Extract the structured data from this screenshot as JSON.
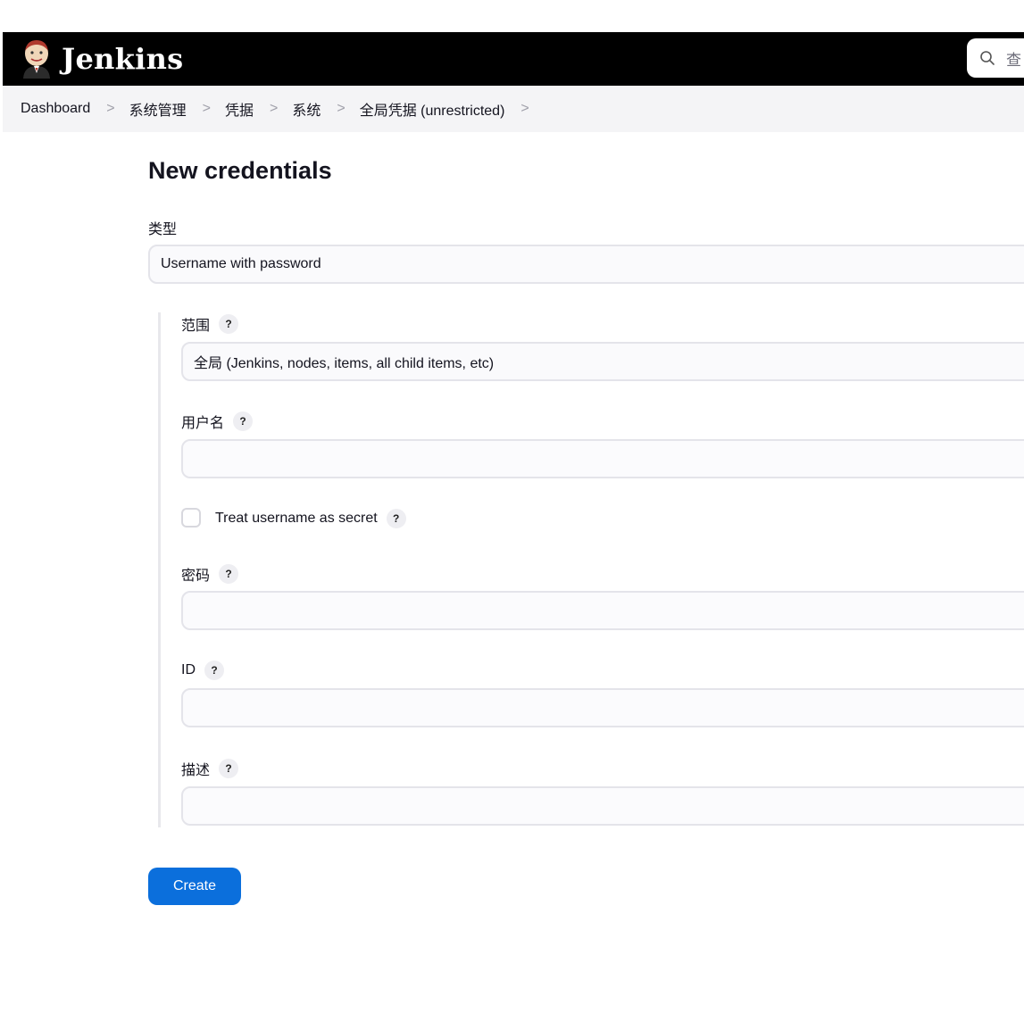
{
  "header": {
    "app_name": "Jenkins",
    "logo_icon": "jenkins-butler-icon",
    "search_icon": "search-icon",
    "search_placeholder": "查"
  },
  "breadcrumbs": [
    "Dashboard",
    "系统管理",
    "凭据",
    "系统",
    "全局凭据 (unrestricted)"
  ],
  "breadcrumb_separator": ">",
  "page": {
    "title": "New credentials"
  },
  "form": {
    "kind": {
      "label": "类型",
      "value": "Username with password"
    },
    "scope": {
      "label": "范围",
      "value": "全局 (Jenkins, nodes, items, all child items, etc)"
    },
    "username": {
      "label": "用户名",
      "value": ""
    },
    "treat_secret": {
      "label": "Treat username as secret",
      "checked": false
    },
    "password": {
      "label": "密码",
      "value": ""
    },
    "id": {
      "label": "ID",
      "value": ""
    },
    "description": {
      "label": "描述",
      "value": ""
    },
    "help_glyph": "?",
    "create_label": "Create"
  },
  "colors": {
    "accent": "#0b6fdc",
    "header_bg": "#000000",
    "breadcrumb_bg": "#f4f4f6"
  }
}
